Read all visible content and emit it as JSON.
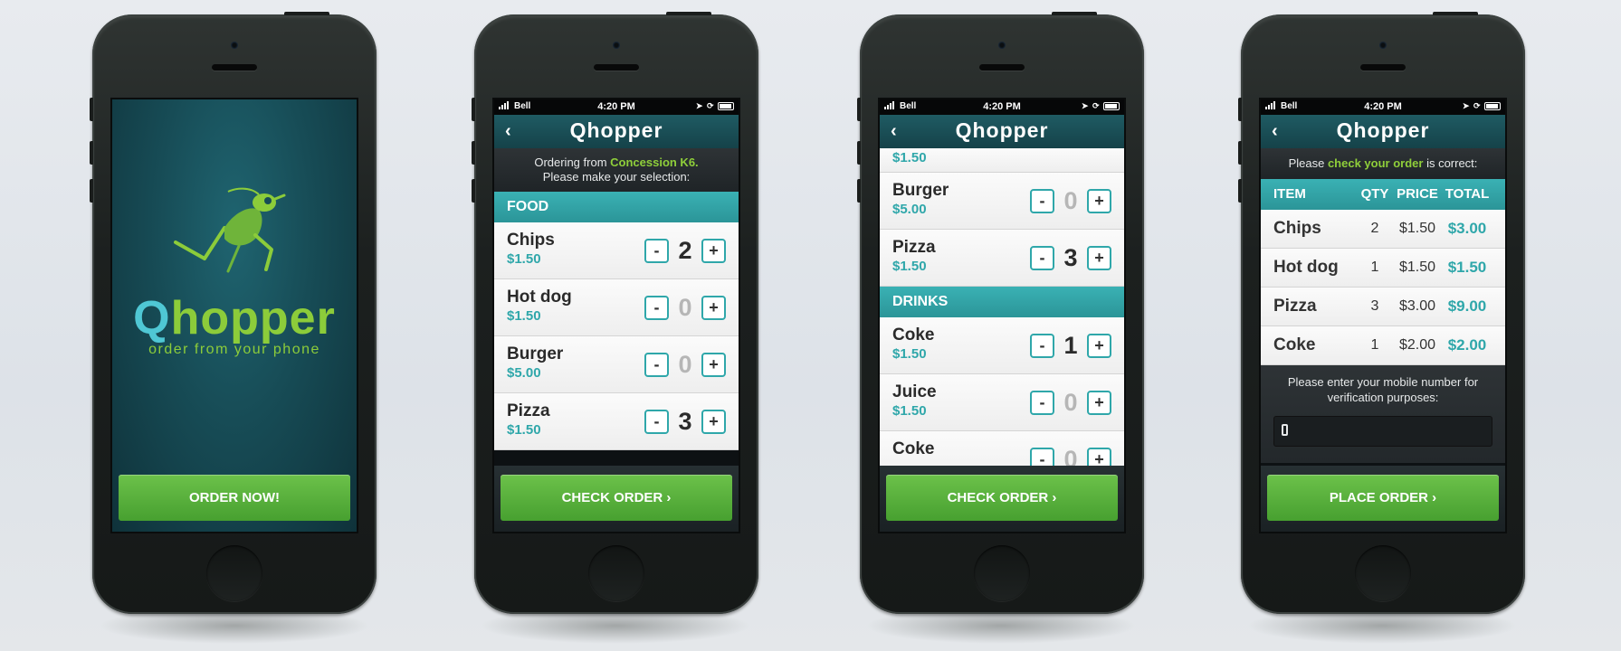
{
  "status_bar": {
    "carrier": "Bell",
    "time": "4:20 PM"
  },
  "app": {
    "brand": "Qhopper",
    "brand_q": "Q",
    "brand_rest": "hopper",
    "tagline": "order from your phone"
  },
  "icons": [
    "back-chevron-icon",
    "signal-icon",
    "location-arrow-icon",
    "lock-rotation-icon",
    "battery-icon",
    "mobile-phone-icon",
    "chevron-right-icon",
    "grasshopper-logo-icon"
  ],
  "colors": {
    "accent": "#2fa7aa",
    "brand_green": "#8ccc3a",
    "cta_green": "#5cb33d",
    "navbar": "#1b4e56"
  },
  "screen1": {
    "cta": "ORDER NOW!"
  },
  "screen2": {
    "intro_prefix": "Ordering from ",
    "venue": "Concession K6.",
    "intro_line2": "Please make your selection:",
    "section": "FOOD",
    "items": [
      {
        "name": "Chips",
        "price": "$1.50",
        "qty": "2"
      },
      {
        "name": "Hot dog",
        "price": "$1.50",
        "qty": "0"
      },
      {
        "name": "Burger",
        "price": "$5.00",
        "qty": "0"
      },
      {
        "name": "Pizza",
        "price": "$1.50",
        "qty": "3"
      }
    ],
    "cta": "CHECK ORDER"
  },
  "screen3": {
    "partial_top_price": "$1.50",
    "food_items": [
      {
        "name": "Burger",
        "price": "$5.00",
        "qty": "0"
      },
      {
        "name": "Pizza",
        "price": "$1.50",
        "qty": "3"
      }
    ],
    "section": "DRINKS",
    "drink_items": [
      {
        "name": "Coke",
        "price": "$1.50",
        "qty": "1"
      },
      {
        "name": "Juice",
        "price": "$1.50",
        "qty": "0"
      },
      {
        "name": "Coke",
        "price": "",
        "qty": "0"
      }
    ],
    "cta": "CHECK ORDER"
  },
  "screen4": {
    "intro_prefix": "Please ",
    "intro_highlight": "check your order",
    "intro_suffix": " is correct:",
    "columns": [
      "ITEM",
      "QTY",
      "PRICE",
      "TOTAL"
    ],
    "rows": [
      {
        "item": "Chips",
        "qty": "2",
        "price": "$1.50",
        "total": "$3.00"
      },
      {
        "item": "Hot dog",
        "qty": "1",
        "price": "$1.50",
        "total": "$1.50"
      },
      {
        "item": "Pizza",
        "qty": "3",
        "price": "$3.00",
        "total": "$9.00"
      },
      {
        "item": "Coke",
        "qty": "1",
        "price": "$2.00",
        "total": "$2.00"
      }
    ],
    "mobile_prompt": "Please enter your mobile number for verification purposes:",
    "mobile_value": "",
    "cta": "PLACE ORDER"
  }
}
